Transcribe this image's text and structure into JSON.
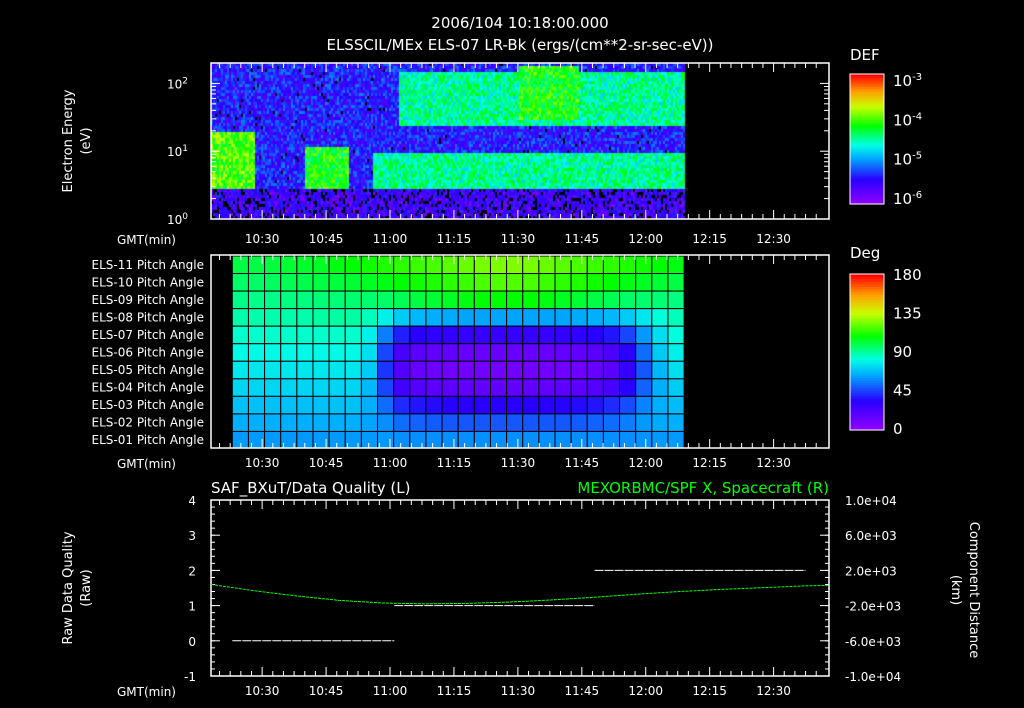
{
  "chart_data": [
    {
      "type": "heatmap",
      "title": "2006/104 10:18:00.000",
      "subtitle": "ELSSCIL/MEx ELS-07 LR-Bk  (ergs/(cm**2-sr-sec-eV))",
      "ylabel_line1": "Electron Energy",
      "ylabel_line2": "(eV)",
      "xlabel": "GMT(min)",
      "x_range_min": [
        618,
        763
      ],
      "data_end_min": 729,
      "y_range": [
        1,
        200
      ],
      "y_scale": "log",
      "y_ticks": [
        {
          "v": 1,
          "label": "10",
          "exp": "0"
        },
        {
          "v": 10,
          "label": "10",
          "exp": "1"
        },
        {
          "v": 100,
          "label": "10",
          "exp": "2"
        }
      ],
      "x_ticks": [
        {
          "v": 630,
          "label": "10:30"
        },
        {
          "v": 645,
          "label": "10:45"
        },
        {
          "v": 660,
          "label": "11:00"
        },
        {
          "v": 675,
          "label": "11:15"
        },
        {
          "v": 690,
          "label": "11:30"
        },
        {
          "v": 705,
          "label": "11:45"
        },
        {
          "v": 720,
          "label": "12:00"
        },
        {
          "v": 735,
          "label": "12:15"
        },
        {
          "v": 750,
          "label": "12:30"
        }
      ],
      "colorbar": {
        "title": "DEF",
        "scale": "log",
        "range": [
          1e-06,
          0.001
        ],
        "ticks": [
          {
            "label": "10",
            "exp": "-3"
          },
          {
            "label": "10",
            "exp": "-4"
          },
          {
            "label": "10",
            "exp": "-5"
          },
          {
            "label": "10",
            "exp": "-6"
          }
        ]
      },
      "bands": [
        {
          "from_min": 618,
          "to_min": 628,
          "e_low": 3,
          "e_high": 20,
          "level": 0.65
        },
        {
          "from_min": 640,
          "to_min": 650,
          "e_low": 3,
          "e_high": 12,
          "level": 0.6
        },
        {
          "from_min": 656,
          "to_min": 729,
          "e_low": 3,
          "e_high": 10,
          "level": 0.5
        },
        {
          "from_min": 662,
          "to_min": 729,
          "e_low": 25,
          "e_high": 150,
          "level": 0.5
        },
        {
          "from_min": 690,
          "to_min": 704,
          "e_low": 30,
          "e_high": 200,
          "level": 0.6
        }
      ]
    },
    {
      "type": "heatmap",
      "xlabel": "GMT(min)",
      "rows": [
        "ELS-11 Pitch Angle",
        "ELS-10 Pitch Angle",
        "ELS-09 Pitch Angle",
        "ELS-08 Pitch Angle",
        "ELS-07 Pitch Angle",
        "ELS-06 Pitch Angle",
        "ELS-05 Pitch Angle",
        "ELS-04 Pitch Angle",
        "ELS-03 Pitch Angle",
        "ELS-02 Pitch Angle",
        "ELS-01 Pitch Angle"
      ],
      "col_start_min": 623,
      "col_end_min": 729,
      "values": [
        [
          100,
          100,
          101,
          102,
          103,
          104,
          106,
          108,
          110,
          112,
          114,
          116,
          118,
          120,
          122,
          124,
          125,
          125,
          124,
          122,
          120,
          118,
          116,
          114,
          112,
          110,
          108,
          106
        ],
        [
          96,
          96,
          97,
          98,
          99,
          100,
          101,
          102,
          104,
          106,
          108,
          110,
          112,
          114,
          116,
          118,
          119,
          119,
          118,
          116,
          114,
          112,
          110,
          108,
          106,
          104,
          102,
          100
        ],
        [
          92,
          92,
          92,
          93,
          93,
          94,
          94,
          95,
          95,
          96,
          98,
          100,
          102,
          104,
          106,
          108,
          108,
          108,
          108,
          106,
          104,
          102,
          100,
          98,
          96,
          95,
          94,
          93
        ],
        [
          88,
          88,
          88,
          88,
          88,
          89,
          89,
          89,
          86,
          78,
          70,
          66,
          64,
          63,
          62,
          62,
          62,
          62,
          62,
          62,
          62,
          63,
          64,
          66,
          70,
          76,
          82,
          86
        ],
        [
          84,
          84,
          84,
          84,
          84,
          84,
          84,
          84,
          78,
          55,
          38,
          32,
          30,
          29,
          28,
          28,
          28,
          28,
          28,
          28,
          29,
          30,
          32,
          36,
          45,
          60,
          74,
          82
        ],
        [
          80,
          80,
          80,
          80,
          80,
          80,
          80,
          80,
          74,
          45,
          22,
          16,
          14,
          13,
          12,
          12,
          12,
          12,
          12,
          12,
          13,
          14,
          16,
          20,
          32,
          52,
          70,
          78
        ],
        [
          76,
          76,
          76,
          76,
          76,
          76,
          76,
          76,
          70,
          42,
          18,
          12,
          10,
          9,
          8,
          8,
          8,
          8,
          8,
          8,
          9,
          10,
          12,
          16,
          28,
          48,
          66,
          74
        ],
        [
          72,
          72,
          72,
          72,
          72,
          72,
          72,
          72,
          66,
          45,
          24,
          18,
          16,
          15,
          14,
          14,
          14,
          14,
          14,
          14,
          15,
          16,
          18,
          22,
          32,
          50,
          64,
          70
        ],
        [
          68,
          68,
          68,
          68,
          68,
          68,
          68,
          68,
          64,
          52,
          40,
          36,
          34,
          33,
          32,
          32,
          32,
          32,
          32,
          32,
          33,
          34,
          36,
          40,
          46,
          56,
          64,
          67
        ],
        [
          64,
          64,
          64,
          64,
          64,
          64,
          64,
          64,
          62,
          58,
          52,
          50,
          49,
          48,
          48,
          48,
          48,
          48,
          48,
          48,
          48,
          49,
          50,
          52,
          55,
          60,
          63,
          64
        ],
        [
          60,
          60,
          60,
          60,
          60,
          60,
          60,
          60,
          60,
          60,
          58,
          58,
          58,
          58,
          58,
          58,
          58,
          58,
          58,
          58,
          58,
          58,
          58,
          58,
          58,
          59,
          60,
          60
        ]
      ],
      "x_ticks": [
        {
          "v": 630,
          "label": "10:30"
        },
        {
          "v": 645,
          "label": "10:45"
        },
        {
          "v": 660,
          "label": "11:00"
        },
        {
          "v": 675,
          "label": "11:15"
        },
        {
          "v": 690,
          "label": "11:30"
        },
        {
          "v": 705,
          "label": "11:45"
        },
        {
          "v": 720,
          "label": "12:00"
        },
        {
          "v": 735,
          "label": "12:15"
        },
        {
          "v": 750,
          "label": "12:30"
        }
      ],
      "colorbar": {
        "title": "Deg",
        "range": [
          0,
          180
        ],
        "ticks": [
          "180",
          "135",
          "90",
          "45",
          "0"
        ]
      }
    },
    {
      "type": "line",
      "title_left": "SAF_BXuT/Data Quality (L)",
      "title_right": "MEXORBMC/SPF X, Spacecraft (R)",
      "ylabel_left_1": "Raw Data Quality",
      "ylabel_left_2": "(Raw)",
      "ylabel_right_1": "Component Distance",
      "ylabel_right_2": "(km)",
      "xlabel": "GMT(min)",
      "ylim_left": [
        -1,
        4
      ],
      "ylim_right": [
        -10000,
        10000
      ],
      "y_ticks_left": [
        "4",
        "3",
        "2",
        "1",
        "0",
        "-1"
      ],
      "y_ticks_right": [
        "1.0e+04",
        "6.0e+03",
        "2.0e+03",
        "-2.0e+03",
        "-6.0e+03",
        "-1.0e+04"
      ],
      "x_ticks": [
        {
          "v": 630,
          "label": "10:30"
        },
        {
          "v": 645,
          "label": "10:45"
        },
        {
          "v": 660,
          "label": "11:00"
        },
        {
          "v": 675,
          "label": "11:15"
        },
        {
          "v": 690,
          "label": "11:30"
        },
        {
          "v": 705,
          "label": "11:45"
        },
        {
          "v": 720,
          "label": "12:00"
        },
        {
          "v": 735,
          "label": "12:15"
        },
        {
          "v": 750,
          "label": "12:30"
        }
      ],
      "quality_segments": [
        {
          "from_min": 623,
          "to_min": 661,
          "value": 0
        },
        {
          "from_min": 661,
          "to_min": 708,
          "value": 1
        },
        {
          "from_min": 708,
          "to_min": 757.5,
          "value": 2
        }
      ],
      "spacecraft_x_km": {
        "t_min": [
          618,
          628,
          638,
          648,
          658,
          668,
          678,
          688,
          698,
          708,
          718,
          728,
          738,
          748,
          758,
          763
        ],
        "values": [
          400,
          -300,
          -900,
          -1400,
          -1700,
          -1800,
          -1750,
          -1600,
          -1350,
          -1050,
          -700,
          -400,
          -150,
          50,
          250,
          300
        ]
      },
      "colors": {
        "quality": "#ffffff",
        "spacecraft": "#00ff00"
      }
    }
  ]
}
